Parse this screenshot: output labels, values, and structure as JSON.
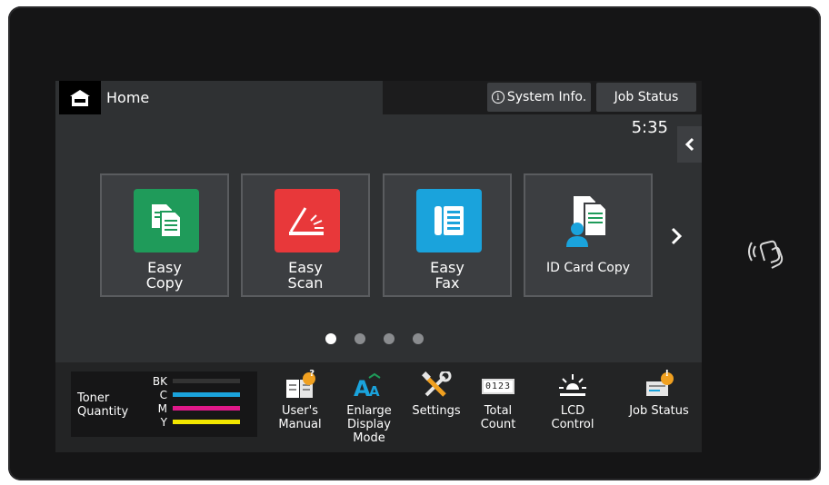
{
  "header": {
    "home_label": "Home",
    "system_info_label": "System Info.",
    "job_status_label": "Job Status",
    "time": "5:35"
  },
  "tiles": [
    {
      "line1": "Easy",
      "line2": "Copy",
      "icon": "copy-icon",
      "color": "#1f9b5a"
    },
    {
      "line1": "Easy",
      "line2": "Scan",
      "icon": "scan-icon",
      "color": "#e8383a"
    },
    {
      "line1": "Easy",
      "line2": "Fax",
      "icon": "fax-icon",
      "color": "#1aa3dc"
    },
    {
      "line1": "ID Card Copy",
      "line2": "",
      "icon": "id-card-copy-icon",
      "color": "#1aa3dc"
    }
  ],
  "pagination": {
    "pages": 4,
    "current": 1
  },
  "toner": {
    "title_line1": "Toner",
    "title_line2": "Quantity",
    "levels": [
      {
        "code": "BK",
        "color": "#333333",
        "level": 0
      },
      {
        "code": "C",
        "color": "#1aa3dc",
        "level": 1
      },
      {
        "code": "M",
        "color": "#e0198a",
        "level": 1
      },
      {
        "code": "Y",
        "color": "#f2e600",
        "level": 1
      }
    ]
  },
  "tools": [
    {
      "lines": [
        "User's",
        "Manual"
      ],
      "icon": "users-manual-icon"
    },
    {
      "lines": [
        "Enlarge",
        "Display",
        "Mode"
      ],
      "icon": "enlarge-display-icon"
    },
    {
      "lines": [
        "Settings"
      ],
      "icon": "settings-icon"
    },
    {
      "lines": [
        "Total",
        "Count"
      ],
      "icon": "total-count-icon",
      "counter_text": "0123"
    },
    {
      "lines": [
        "LCD",
        "Control"
      ],
      "icon": "lcd-control-icon"
    },
    {
      "lines": [
        "Job Status"
      ],
      "icon": "job-status-icon"
    }
  ],
  "icons": {
    "info": "i",
    "badge_question": "?",
    "badge_exclaim": "!"
  }
}
